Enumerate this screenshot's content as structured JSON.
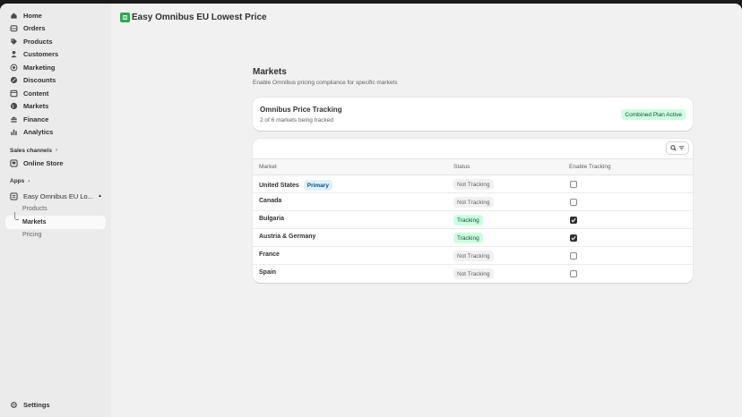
{
  "sidebar": {
    "nav": [
      {
        "label": "Home",
        "icon": "home-icon"
      },
      {
        "label": "Orders",
        "icon": "orders-icon"
      },
      {
        "label": "Products",
        "icon": "tag-icon"
      },
      {
        "label": "Customers",
        "icon": "person-icon"
      },
      {
        "label": "Marketing",
        "icon": "target-icon"
      },
      {
        "label": "Discounts",
        "icon": "discount-icon"
      },
      {
        "label": "Content",
        "icon": "content-icon"
      },
      {
        "label": "Markets",
        "icon": "globe-icon"
      },
      {
        "label": "Finance",
        "icon": "bank-icon"
      },
      {
        "label": "Analytics",
        "icon": "chart-icon"
      }
    ],
    "sales_channels_label": "Sales channels",
    "online_store_label": "Online Store",
    "apps_label": "Apps",
    "app_name": "Easy Omnibus EU Lo...",
    "app_sub": [
      "Products",
      "Markets",
      "Pricing"
    ],
    "settings_label": "Settings"
  },
  "header": {
    "app_title": "Easy Omnibus EU Lowest Price"
  },
  "page": {
    "title": "Markets",
    "subtitle": "Enable Omnibus pricing compliance for specific markets"
  },
  "summary": {
    "title": "Omnibus Price Tracking",
    "subtitle": "2 of 6 markets being tracked",
    "plan_badge": "Combined Plan Active"
  },
  "table": {
    "columns": [
      "Market",
      "Status",
      "Enable Tracking"
    ],
    "rows": [
      {
        "market": "United States",
        "tag": "Primary",
        "status": "Not Tracking",
        "tracked": false
      },
      {
        "market": "Canada",
        "tag": "",
        "status": "Not Tracking",
        "tracked": false
      },
      {
        "market": "Bulgaria",
        "tag": "",
        "status": "Tracking",
        "tracked": true
      },
      {
        "market": "Austria & Germany",
        "tag": "",
        "status": "Tracking",
        "tracked": true
      },
      {
        "market": "France",
        "tag": "",
        "status": "Not Tracking",
        "tracked": false
      },
      {
        "market": "Spain",
        "tag": "",
        "status": "Not Tracking",
        "tracked": false
      }
    ]
  },
  "colors": {
    "tracking_bg": "#cdfee1",
    "not_tracking_bg": "#f1f1f1",
    "primary_bg": "#e0f0ff",
    "app_logo": "#2fa84f"
  }
}
